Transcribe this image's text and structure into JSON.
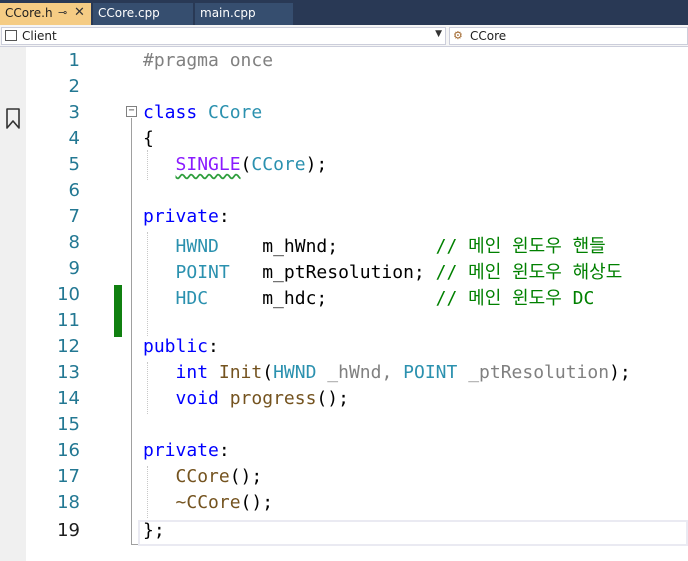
{
  "tabs": [
    {
      "label": "CCore.h",
      "active": true
    },
    {
      "label": "CCore.cpp",
      "active": false
    },
    {
      "label": "main.cpp",
      "active": false
    }
  ],
  "tab_pin_glyph": "⊸",
  "tab_close_glyph": "✕",
  "nav": {
    "project": "Client",
    "scope": "CCore"
  },
  "editor": {
    "current_line": 19,
    "changed_lines": [
      10,
      11
    ],
    "line_numbers": [
      "1",
      "2",
      "3",
      "4",
      "5",
      "6",
      "7",
      "8",
      "9",
      "10",
      "11",
      "12",
      "13",
      "14",
      "15",
      "16",
      "17",
      "18",
      "19"
    ]
  },
  "colors": {
    "keyword": "#0000ff",
    "type": "#2b91af",
    "function": "#74531f",
    "macro": "#8a1bff",
    "comment": "#008000",
    "preprocessor": "#808080",
    "line_number": "#237893",
    "change_marker": "#108010"
  },
  "code": {
    "l1_pp": "#pragma once",
    "l3_kw": "class",
    "l3_name": "CCore",
    "l4": "{",
    "l5_macro": "SINGLE",
    "l5_open": "(",
    "l5_type": "CCore",
    "l5_close": ");",
    "l7_kw": "private",
    "l7_colon": ":",
    "l8_type": "HWND",
    "l8_var": "m_hWnd;",
    "l8_cm": "// 메인 윈도우 핸들",
    "l9_type": "POINT",
    "l9_var": "m_ptResolution;",
    "l9_cm": "// 메인 윈도우 해상도",
    "l10_type": "HDC",
    "l10_var": "m_hdc;",
    "l10_cm": "// 메인 윈도우 DC",
    "l12_kw": "public",
    "l12_colon": ":",
    "l13_kw": "int",
    "l13_fn": "Init",
    "l13_open": "(",
    "l13_t1": "HWND",
    "l13_p1": "_hWnd,",
    "l13_t2": "POINT",
    "l13_p2": "_ptResolution",
    "l13_close": ");",
    "l14_kw": "void",
    "l14_fn": "progress",
    "l14_rest": "();",
    "l16_kw": "private",
    "l16_colon": ":",
    "l17_fn": "CCore",
    "l17_rest": "();",
    "l18_fn": "~CCore",
    "l18_rest": "();",
    "l19": "};"
  }
}
